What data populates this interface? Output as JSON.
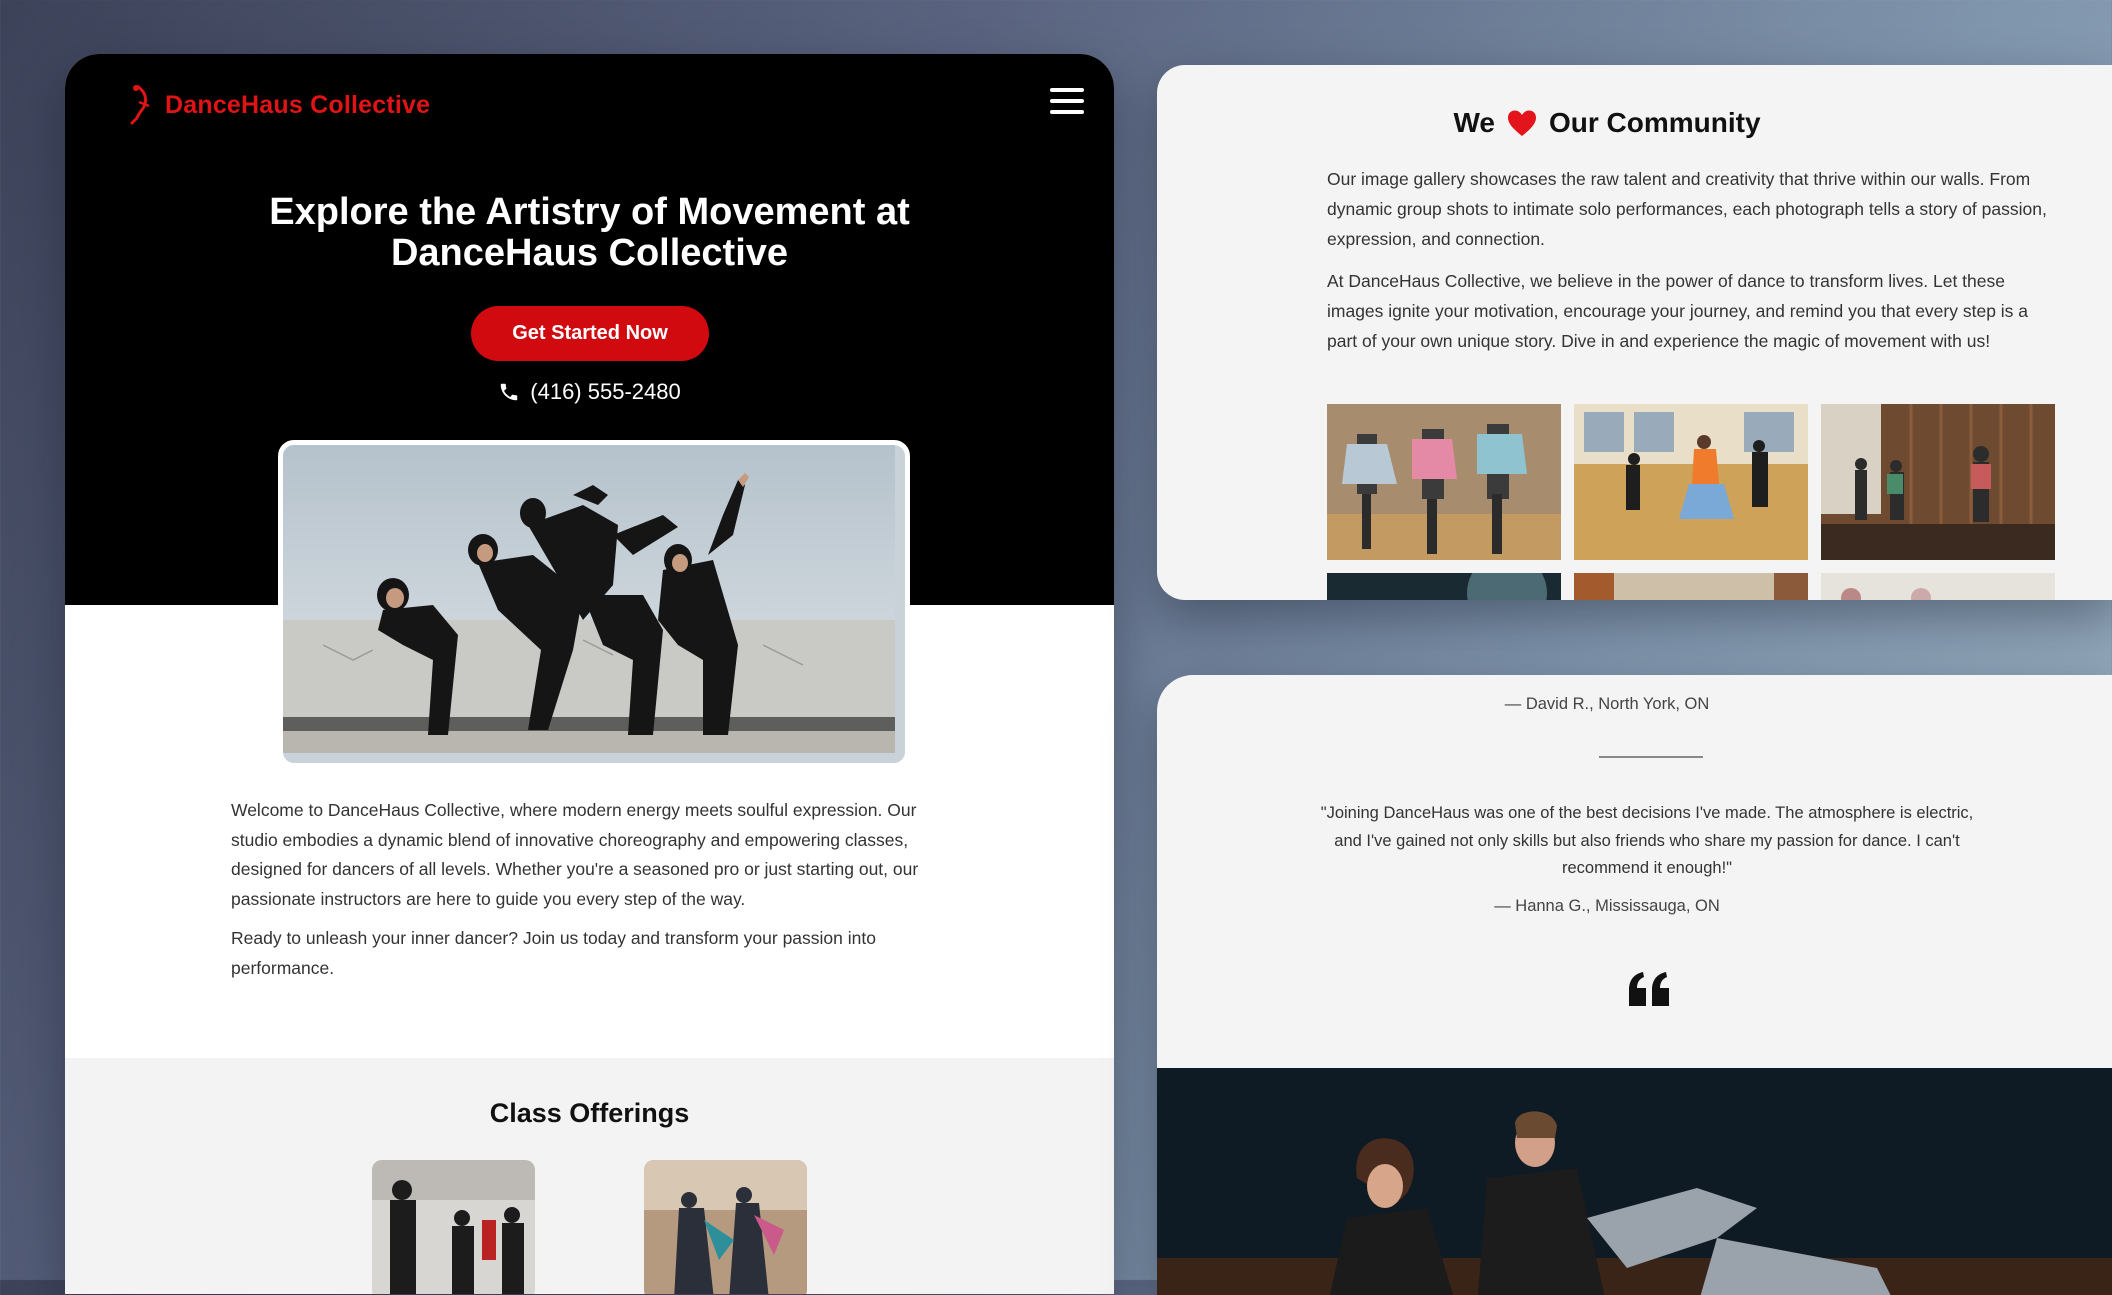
{
  "brand": {
    "name": "DanceHaus Collective",
    "accent": "#e01316"
  },
  "nav": {
    "menu_icon": "hamburger-menu-icon"
  },
  "hero": {
    "title": "Explore the Artistry of Movement at DanceHaus Collective",
    "cta_label": "Get Started Now",
    "phone": "(416) 555-2480"
  },
  "intro": {
    "paragraphs": [
      "Welcome to DanceHaus Collective, where modern energy meets soulful expression. Our studio embodies a dynamic blend of innovative choreography and empowering classes, designed for dancers of all levels. Whether you're a seasoned pro or just starting out, our passionate instructors are here to guide you every step of the way.",
      "Ready to unleash your inner dancer? Join us today and transform your passion into performance."
    ]
  },
  "classes": {
    "title": "Class Offerings"
  },
  "gallery": {
    "title_before": "We",
    "title_after": "Our Community",
    "paragraphs": [
      "Our image gallery showcases the raw talent and creativity that thrive within our walls. From dynamic group shots to intimate solo performances, each photograph tells a story of passion, expression, and connection.",
      "At DanceHaus Collective, we believe in the power of dance to transform lives. Let these images ignite your motivation, encourage your journey, and remind you that every step is a part of your own unique story. Dive in and experience the magic of movement with us!"
    ]
  },
  "testimonials": {
    "previous_attribution": "—  David R., North York, ON",
    "quote": "\"Joining DanceHaus was one of the best decisions I've made. The atmosphere is electric, and I've gained not only skills but also friends who share my passion for dance. I can't recommend it enough!\"",
    "attribution": "—  Hanna G., Mississauga, ON"
  }
}
